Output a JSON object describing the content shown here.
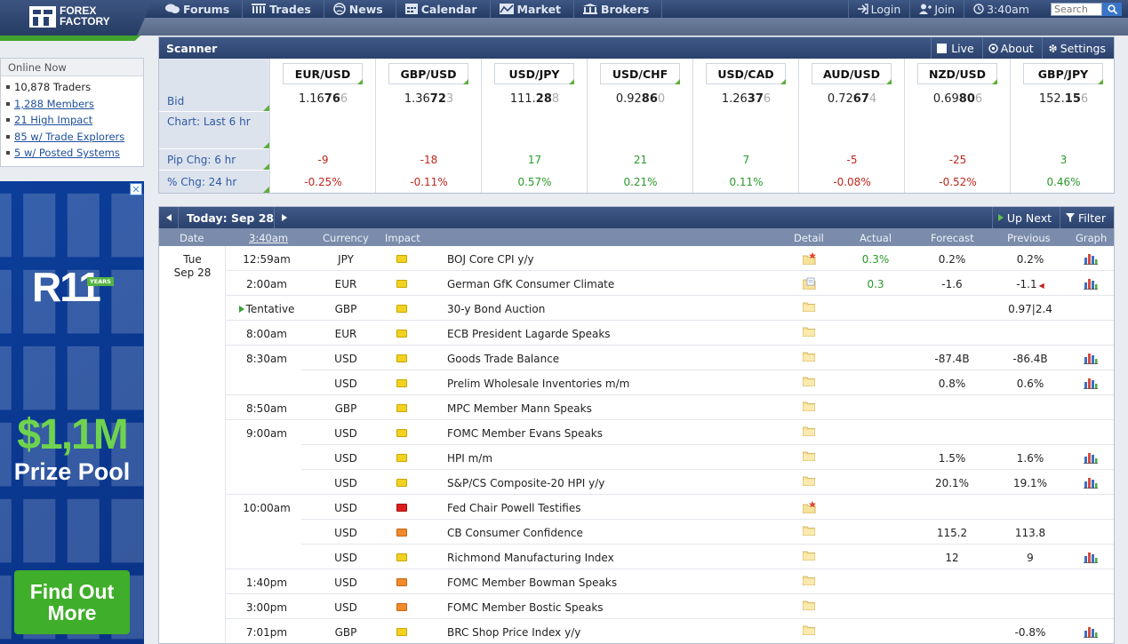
{
  "brand": {
    "line1": "FOREX",
    "line2": "FACTORY"
  },
  "nav": [
    {
      "label": "Forums",
      "icon": "forums-icon"
    },
    {
      "label": "Trades",
      "icon": "trades-icon"
    },
    {
      "label": "News",
      "icon": "news-icon"
    },
    {
      "label": "Calendar",
      "icon": "calendar-icon"
    },
    {
      "label": "Market",
      "icon": "market-icon"
    },
    {
      "label": "Brokers",
      "icon": "brokers-icon"
    }
  ],
  "account": {
    "login": "Login",
    "join": "Join",
    "time": "3:40am",
    "search_placeholder": "Search"
  },
  "online": {
    "title": "Online Now",
    "items": [
      {
        "text": "10,878 Traders",
        "link": false
      },
      {
        "text": "1,288 Members",
        "link": true
      },
      {
        "text": "21 High Impact",
        "link": true
      },
      {
        "text": "85 w/ Trade Explorers",
        "link": true
      },
      {
        "text": "5 w/ Posted Systems",
        "link": true
      }
    ]
  },
  "ad": {
    "close": "✕",
    "brand": "R11",
    "years": "YEARS",
    "amount": "$1,1M",
    "label": "Prize Pool",
    "cta": "Find Out More"
  },
  "scanner": {
    "title": "Scanner",
    "live": "Live",
    "about": "About",
    "settings": "Settings",
    "labels": [
      "Bid",
      "Chart: Last 6 hr",
      "Pip Chg: 6 hr",
      "% Chg: 24 hr"
    ],
    "pairs": [
      {
        "pair": "EUR/USD",
        "bid_a": "1.16",
        "bid_b": "76",
        "bid_c": "6",
        "pip": "-9",
        "pct": "-0.25%"
      },
      {
        "pair": "GBP/USD",
        "bid_a": "1.36",
        "bid_b": "72",
        "bid_c": "3",
        "pip": "-18",
        "pct": "-0.11%"
      },
      {
        "pair": "USD/JPY",
        "bid_a": "111.",
        "bid_b": "28",
        "bid_c": "8",
        "pip": "17",
        "pct": "0.57%"
      },
      {
        "pair": "USD/CHF",
        "bid_a": "0.92",
        "bid_b": "86",
        "bid_c": "0",
        "pip": "21",
        "pct": "0.21%"
      },
      {
        "pair": "USD/CAD",
        "bid_a": "1.26",
        "bid_b": "37",
        "bid_c": "6",
        "pip": "7",
        "pct": "0.11%"
      },
      {
        "pair": "AUD/USD",
        "bid_a": "0.72",
        "bid_b": "67",
        "bid_c": "4",
        "pip": "-5",
        "pct": "-0.08%"
      },
      {
        "pair": "NZD/USD",
        "bid_a": "0.69",
        "bid_b": "80",
        "bid_c": "6",
        "pip": "-25",
        "pct": "-0.52%"
      },
      {
        "pair": "GBP/JPY",
        "bid_a": "152.",
        "bid_b": "15",
        "bid_c": "6",
        "pip": "3",
        "pct": "0.46%"
      }
    ]
  },
  "calendar": {
    "today": "Today: Sep 28",
    "up_next": "Up Next",
    "filter": "Filter",
    "headers": {
      "date": "Date",
      "time": "3:40am",
      "currency": "Currency",
      "impact": "Impact",
      "detail": "Detail",
      "actual": "Actual",
      "forecast": "Forecast",
      "previous": "Previous",
      "graph": "Graph"
    },
    "day": {
      "weekday": "Tue",
      "date": "Sep 28"
    },
    "events": [
      {
        "time": "12:59am",
        "cur": "JPY",
        "impact": "yellow",
        "event": "BOJ Core CPI y/y",
        "detail": "star",
        "actual": "0.3%",
        "forecast": "0.2%",
        "previous": "0.2%",
        "graph": true
      },
      {
        "time": "2:00am",
        "cur": "EUR",
        "impact": "yellow",
        "event": "German GfK Consumer Climate",
        "detail": "open",
        "actual": "0.3",
        "forecast": "-1.6",
        "previous": "-1.1",
        "revised": true,
        "graph": true
      },
      {
        "time": "Tentative",
        "cur": "GBP",
        "impact": "yellow",
        "event": "30-y Bond Auction",
        "detail": "folder",
        "actual": "",
        "forecast": "",
        "previous": "0.97|2.4",
        "graph": false,
        "tentative": true
      },
      {
        "time": "8:00am",
        "cur": "EUR",
        "impact": "yellow",
        "event": "ECB President Lagarde Speaks",
        "detail": "folder",
        "actual": "",
        "forecast": "",
        "previous": "",
        "graph": false
      },
      {
        "time": "8:30am",
        "cur": "USD",
        "impact": "yellow",
        "event": "Goods Trade Balance",
        "detail": "folder",
        "actual": "",
        "forecast": "-87.4B",
        "previous": "-86.4B",
        "graph": true
      },
      {
        "time": "",
        "cur": "USD",
        "impact": "yellow",
        "event": "Prelim Wholesale Inventories m/m",
        "detail": "folder",
        "actual": "",
        "forecast": "0.8%",
        "previous": "0.6%",
        "graph": true
      },
      {
        "time": "8:50am",
        "cur": "GBP",
        "impact": "yellow",
        "event": "MPC Member Mann Speaks",
        "detail": "folder",
        "actual": "",
        "forecast": "",
        "previous": "",
        "graph": false
      },
      {
        "time": "9:00am",
        "cur": "USD",
        "impact": "yellow",
        "event": "FOMC Member Evans Speaks",
        "detail": "folder",
        "actual": "",
        "forecast": "",
        "previous": "",
        "graph": false
      },
      {
        "time": "",
        "cur": "USD",
        "impact": "yellow",
        "event": "HPI m/m",
        "detail": "folder",
        "actual": "",
        "forecast": "1.5%",
        "previous": "1.6%",
        "graph": true
      },
      {
        "time": "",
        "cur": "USD",
        "impact": "yellow",
        "event": "S&P/CS Composite-20 HPI y/y",
        "detail": "folder",
        "actual": "",
        "forecast": "20.1%",
        "previous": "19.1%",
        "graph": true
      },
      {
        "time": "10:00am",
        "cur": "USD",
        "impact": "red",
        "event": "Fed Chair Powell Testifies",
        "detail": "star",
        "actual": "",
        "forecast": "",
        "previous": "",
        "graph": false
      },
      {
        "time": "",
        "cur": "USD",
        "impact": "orange",
        "event": "CB Consumer Confidence",
        "detail": "folder",
        "actual": "",
        "forecast": "115.2",
        "previous": "113.8",
        "graph": false
      },
      {
        "time": "",
        "cur": "USD",
        "impact": "yellow",
        "event": "Richmond Manufacturing Index",
        "detail": "folder",
        "actual": "",
        "forecast": "12",
        "previous": "9",
        "graph": true
      },
      {
        "time": "1:40pm",
        "cur": "USD",
        "impact": "orange",
        "event": "FOMC Member Bowman Speaks",
        "detail": "folder",
        "actual": "",
        "forecast": "",
        "previous": "",
        "graph": false
      },
      {
        "time": "3:00pm",
        "cur": "USD",
        "impact": "orange",
        "event": "FOMC Member Bostic Speaks",
        "detail": "folder",
        "actual": "",
        "forecast": "",
        "previous": "",
        "graph": false
      },
      {
        "time": "7:01pm",
        "cur": "GBP",
        "impact": "yellow",
        "event": "BRC Shop Price Index y/y",
        "detail": "folder",
        "actual": "",
        "forecast": "",
        "previous": "-0.8%",
        "graph": true
      }
    ]
  }
}
